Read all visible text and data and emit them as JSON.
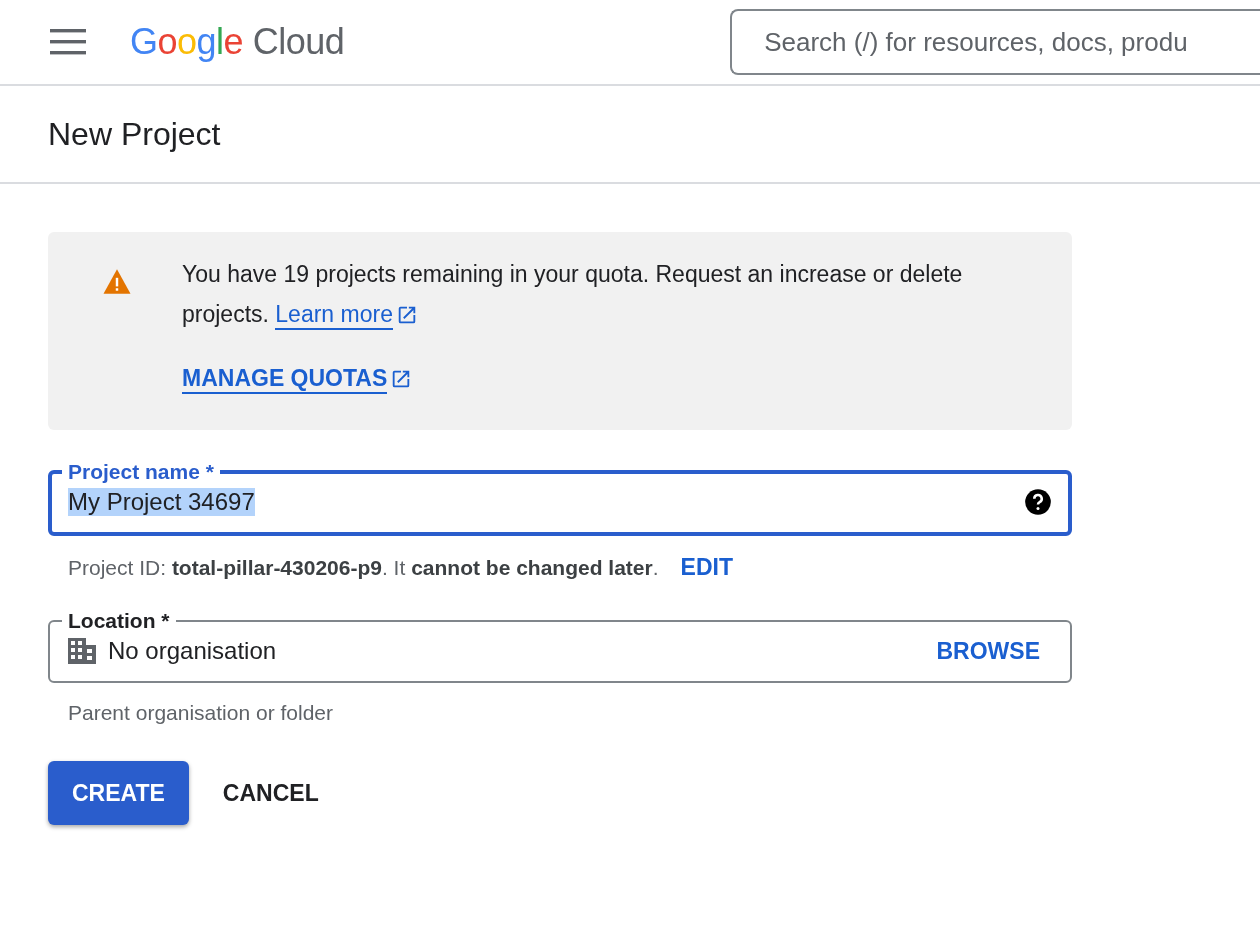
{
  "header": {
    "brand": "Google",
    "product": "Cloud",
    "search": {
      "placeholder": "Search (/) for resources, docs, produ"
    }
  },
  "page_title": "New Project",
  "notice": {
    "text": "You have 19 projects remaining in your quota. Request an increase or delete projects.",
    "link": "Learn more",
    "action": "MANAGE QUOTAS"
  },
  "project_name": {
    "label": "Project name *",
    "value": "My Project 34697",
    "value_selected": true,
    "focused": true
  },
  "project_id_hint": "Project ID: **total-pillar-430206-p9**. It **cannot be changed later**.",
  "edit_link": "EDIT",
  "location": {
    "label": "Location *",
    "value": "No organisation",
    "action": "BROWSE",
    "hint": "Parent organisation or folder"
  },
  "buttons": [
    {
      "label": "CREATE",
      "kind": "primary"
    },
    {
      "label": "CANCEL",
      "kind": "text"
    }
  ]
}
